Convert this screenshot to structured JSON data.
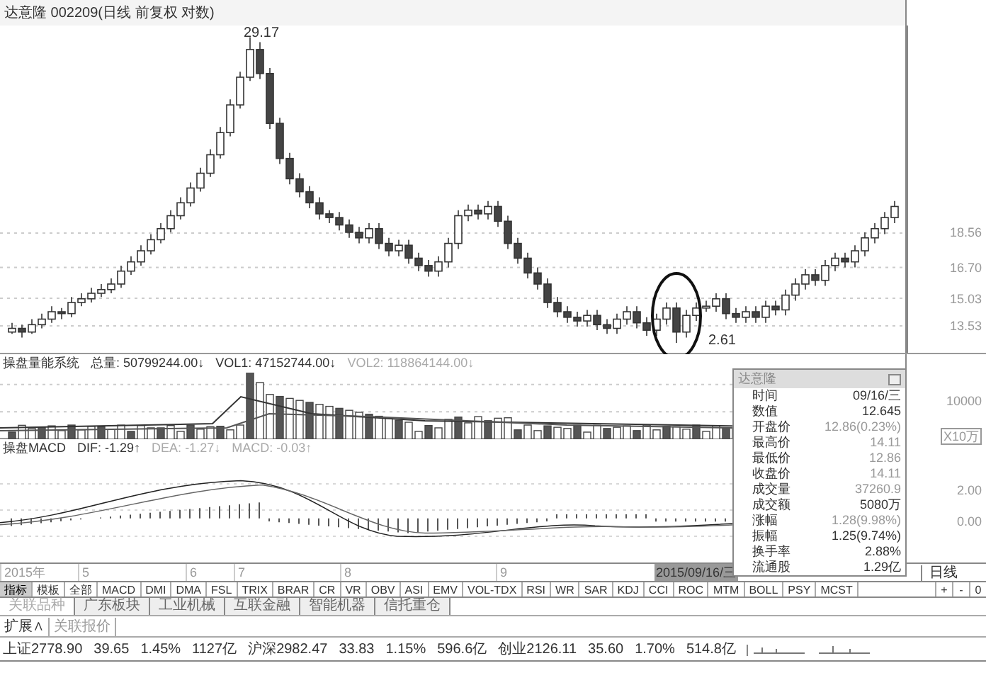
{
  "title": "达意隆 002209(日线 前复权 对数)",
  "price_marks": {
    "high": "29.17",
    "low": "2.61"
  },
  "price_chart": {
    "chart_data": {
      "type": "candlestick",
      "grid": true,
      "ylim": [
        12.0,
        29.8
      ],
      "yticks": [
        {
          "value": 18.56,
          "label": "18.56"
        },
        {
          "value": 16.7,
          "label": "16.70"
        },
        {
          "value": 15.03,
          "label": "15.03"
        },
        {
          "value": 13.53,
          "label": "13.53"
        }
      ],
      "ohlc": [
        [
          13.2,
          13.7,
          13.1,
          13.4
        ],
        [
          13.4,
          13.6,
          12.9,
          13.2
        ],
        [
          13.2,
          13.9,
          13.1,
          13.6
        ],
        [
          13.6,
          14.2,
          13.4,
          13.9
        ],
        [
          13.9,
          14.6,
          13.7,
          14.3
        ],
        [
          14.3,
          14.5,
          13.9,
          14.2
        ],
        [
          14.2,
          15.1,
          14.0,
          14.8
        ],
        [
          14.8,
          15.3,
          14.6,
          15.0
        ],
        [
          15.0,
          15.6,
          14.8,
          15.3
        ],
        [
          15.3,
          15.8,
          15.1,
          15.5
        ],
        [
          15.5,
          16.1,
          15.3,
          15.8
        ],
        [
          15.8,
          16.8,
          15.6,
          16.5
        ],
        [
          16.5,
          17.3,
          16.3,
          17.0
        ],
        [
          17.0,
          17.9,
          16.8,
          17.6
        ],
        [
          17.6,
          18.5,
          17.4,
          18.2
        ],
        [
          18.2,
          19.1,
          18.0,
          18.8
        ],
        [
          18.8,
          19.8,
          18.6,
          19.5
        ],
        [
          19.5,
          20.5,
          19.3,
          20.2
        ],
        [
          20.2,
          21.3,
          20.0,
          21.0
        ],
        [
          21.0,
          22.1,
          20.8,
          21.8
        ],
        [
          21.8,
          23.1,
          21.6,
          22.8
        ],
        [
          22.8,
          24.3,
          22.6,
          24.0
        ],
        [
          24.0,
          25.8,
          23.8,
          25.5
        ],
        [
          25.5,
          27.3,
          25.3,
          27.0
        ],
        [
          27.0,
          29.17,
          26.8,
          28.5
        ],
        [
          28.5,
          28.9,
          26.9,
          27.2
        ],
        [
          27.2,
          27.5,
          24.2,
          24.5
        ],
        [
          24.5,
          24.8,
          22.3,
          22.6
        ],
        [
          22.6,
          22.9,
          21.2,
          21.5
        ],
        [
          21.5,
          21.8,
          20.5,
          20.8
        ],
        [
          20.8,
          21.1,
          19.9,
          20.2
        ],
        [
          20.2,
          20.5,
          19.3,
          19.6
        ],
        [
          19.6,
          19.8,
          19.1,
          19.4
        ],
        [
          19.4,
          19.7,
          18.7,
          19.0
        ],
        [
          19.0,
          19.3,
          18.3,
          18.6
        ],
        [
          18.6,
          18.9,
          18.0,
          18.3
        ],
        [
          18.3,
          19.1,
          18.0,
          18.8
        ],
        [
          18.8,
          19.1,
          17.7,
          18.0
        ],
        [
          18.0,
          18.3,
          17.3,
          17.6
        ],
        [
          17.6,
          18.2,
          17.3,
          17.9
        ],
        [
          17.9,
          18.2,
          16.9,
          17.2
        ],
        [
          17.2,
          17.5,
          16.5,
          16.8
        ],
        [
          16.8,
          17.1,
          16.2,
          16.5
        ],
        [
          16.5,
          17.3,
          16.2,
          17.0
        ],
        [
          17.0,
          18.3,
          16.7,
          18.0
        ],
        [
          18.0,
          19.8,
          17.7,
          19.5
        ],
        [
          19.5,
          20.1,
          19.2,
          19.8
        ],
        [
          19.8,
          20.1,
          19.3,
          19.6
        ],
        [
          19.6,
          20.3,
          19.3,
          20.0
        ],
        [
          20.0,
          20.3,
          18.9,
          19.2
        ],
        [
          19.2,
          19.5,
          17.7,
          18.0
        ],
        [
          18.0,
          18.3,
          16.9,
          17.2
        ],
        [
          17.2,
          17.5,
          16.1,
          16.4
        ],
        [
          16.4,
          16.7,
          15.5,
          15.8
        ],
        [
          15.8,
          16.1,
          14.5,
          14.8
        ],
        [
          14.8,
          15.1,
          14.0,
          14.3
        ],
        [
          14.3,
          14.6,
          13.7,
          14.0
        ],
        [
          14.0,
          14.3,
          13.5,
          13.8
        ],
        [
          13.8,
          14.4,
          13.5,
          14.1
        ],
        [
          14.1,
          14.4,
          13.3,
          13.6
        ],
        [
          13.6,
          13.9,
          13.1,
          13.4
        ],
        [
          13.4,
          14.2,
          13.1,
          13.9
        ],
        [
          13.9,
          14.6,
          13.6,
          14.3
        ],
        [
          14.3,
          14.6,
          13.4,
          13.7
        ],
        [
          13.7,
          14.0,
          13.0,
          13.3
        ],
        [
          13.3,
          14.2,
          13.0,
          13.9
        ],
        [
          13.9,
          14.8,
          13.6,
          14.5
        ],
        [
          14.5,
          14.8,
          12.61,
          13.2
        ],
        [
          13.2,
          14.4,
          12.9,
          14.1
        ],
        [
          14.1,
          14.8,
          13.8,
          14.5
        ],
        [
          14.5,
          14.9,
          14.3,
          14.6
        ],
        [
          14.6,
          15.3,
          14.3,
          15.0
        ],
        [
          15.0,
          15.3,
          13.9,
          14.2
        ],
        [
          14.2,
          14.5,
          13.7,
          14.0
        ],
        [
          14.0,
          14.6,
          13.7,
          14.3
        ],
        [
          14.3,
          14.6,
          13.7,
          14.0
        ],
        [
          14.0,
          14.9,
          13.7,
          14.6
        ],
        [
          14.6,
          14.9,
          14.1,
          14.4
        ],
        [
          14.4,
          15.5,
          14.1,
          15.2
        ],
        [
          15.2,
          16.1,
          14.9,
          15.8
        ],
        [
          15.8,
          16.6,
          15.5,
          16.3
        ],
        [
          16.3,
          16.6,
          15.7,
          16.0
        ],
        [
          16.0,
          17.1,
          15.7,
          16.8
        ],
        [
          16.8,
          17.5,
          16.5,
          17.2
        ],
        [
          17.2,
          17.5,
          16.7,
          17.0
        ],
        [
          17.0,
          17.9,
          16.7,
          17.6
        ],
        [
          17.6,
          18.6,
          17.3,
          18.3
        ],
        [
          18.3,
          19.1,
          18.0,
          18.8
        ],
        [
          18.8,
          19.7,
          18.5,
          19.4
        ],
        [
          19.4,
          20.3,
          19.1,
          20.0
        ]
      ]
    }
  },
  "volume_header": {
    "name": "操盘量能系统",
    "items": [
      {
        "label": "总量:",
        "value": "50799244.00↓",
        "faded": false
      },
      {
        "label": "VOL1:",
        "value": "47152744.00↓",
        "faded": false
      },
      {
        "label": "VOL2:",
        "value": "118864144.00↓",
        "faded": true
      }
    ]
  },
  "volume_axis": {
    "tick": "10000",
    "unit": "X10万"
  },
  "macd_header": {
    "name": "操盘MACD",
    "items": [
      {
        "label": "DIF:",
        "value": "-1.29↑",
        "faded": false
      },
      {
        "label": "DEA:",
        "value": "-1.27↓",
        "faded": true
      },
      {
        "label": "MACD:",
        "value": "-0.03↑",
        "faded": true
      }
    ]
  },
  "macd_axis": [
    "2.00",
    "0.00"
  ],
  "info_panel": {
    "title": "达意隆",
    "rows": [
      {
        "label": "时间",
        "value": "09/16/三",
        "faded": false
      },
      {
        "label": "数值",
        "value": "12.645",
        "faded": false
      },
      {
        "label": "开盘价",
        "value": "12.86(0.23%)",
        "faded": true
      },
      {
        "label": "最高价",
        "value": "14.11",
        "faded": true
      },
      {
        "label": "最低价",
        "value": "12.86",
        "faded": true
      },
      {
        "label": "收盘价",
        "value": "14.11",
        "faded": true
      },
      {
        "label": "成交量",
        "value": "37260.9",
        "faded": true
      },
      {
        "label": "成交额",
        "value": "5080万",
        "faded": false
      },
      {
        "label": "涨幅",
        "value": "1.28(9.98%)",
        "faded": true
      },
      {
        "label": "振幅",
        "value": "1.25(9.74%)",
        "faded": false
      },
      {
        "label": "换手率",
        "value": "2.88%",
        "faded": false
      },
      {
        "label": "流通股",
        "value": "1.29亿",
        "faded": false
      }
    ]
  },
  "date_axis": [
    "2015年",
    "5",
    "6",
    "7",
    "8",
    "9"
  ],
  "cursor_date": "2015/09/16/三",
  "period": "日线",
  "indicator_tabs": [
    {
      "label": "指标",
      "selected": true
    },
    {
      "label": "模板",
      "selected": false
    },
    {
      "label": "全部",
      "selected": false
    },
    {
      "label": "MACD",
      "selected": false
    },
    {
      "label": "DMI",
      "selected": false
    },
    {
      "label": "DMA",
      "selected": false
    },
    {
      "label": "FSL",
      "selected": false
    },
    {
      "label": "TRIX",
      "selected": false
    },
    {
      "label": "BRAR",
      "selected": false
    },
    {
      "label": "CR",
      "selected": false
    },
    {
      "label": "VR",
      "selected": false
    },
    {
      "label": "OBV",
      "selected": false
    },
    {
      "label": "ASI",
      "selected": false
    },
    {
      "label": "EMV",
      "selected": false
    },
    {
      "label": "VOL-TDX",
      "selected": false
    },
    {
      "label": "RSI",
      "selected": false
    },
    {
      "label": "WR",
      "selected": false
    },
    {
      "label": "SAR",
      "selected": false
    },
    {
      "label": "KDJ",
      "selected": false
    },
    {
      "label": "CCI",
      "selected": false
    },
    {
      "label": "ROC",
      "selected": false
    },
    {
      "label": "MTM",
      "selected": false
    },
    {
      "label": "BOLL",
      "selected": false
    },
    {
      "label": "PSY",
      "selected": false
    },
    {
      "label": "MCST",
      "selected": false
    }
  ],
  "zoom_buttons": [
    "+",
    "-",
    "0"
  ],
  "sector_tabs": [
    {
      "label": "关联品种",
      "selected": true
    },
    {
      "label": "广东板块",
      "selected": false
    },
    {
      "label": "工业机械",
      "selected": false
    },
    {
      "label": "互联金融",
      "selected": false
    },
    {
      "label": "智能机器",
      "selected": false
    },
    {
      "label": "信托重仓",
      "selected": false
    }
  ],
  "extra_tabs": [
    {
      "label": "扩展∧",
      "selected": true
    },
    {
      "label": "关联报价",
      "selected": false
    }
  ],
  "status_bar": [
    {
      "name": "上证2778.90",
      "change": "39.65",
      "percent": "1.45%",
      "amount": "1127亿"
    },
    {
      "name": "沪深2982.47",
      "change": "33.83",
      "percent": "1.15%",
      "amount": "596.6亿"
    },
    {
      "name": "创业2126.11",
      "change": "35.60",
      "percent": "1.70%",
      "amount": "514.8亿"
    }
  ]
}
